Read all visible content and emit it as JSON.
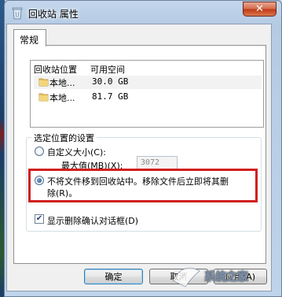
{
  "window": {
    "title": "回收站 属性",
    "close_glyph": "✕"
  },
  "tabs": [
    {
      "label": "常规"
    }
  ],
  "locations": {
    "columns": [
      "回收站位置",
      "可用空间"
    ],
    "rows": [
      {
        "name": "本地...",
        "free_space": "30.0 GB"
      },
      {
        "name": "本地...",
        "free_space": "81.7 GB"
      }
    ]
  },
  "settings": {
    "group_title": "选定位置的设置",
    "custom_size_label": "自定义大小(C):",
    "max_value_label": "最大值(MB)(X):",
    "max_value": "3072",
    "no_recycle_label_line1": "不将文件移到回收站中。移除文件后立即将其删",
    "no_recycle_label_line2": "除(R)。",
    "selected_option": "no_recycle",
    "confirm_delete_label": "显示删除确认对话框(D)",
    "confirm_delete_checked": true
  },
  "buttons": {
    "ok": "确定",
    "cancel": "取消",
    "apply": "应用(A)"
  },
  "watermark": {
    "text": "系统之家"
  },
  "colors": {
    "highlight_box": "#d11f1f",
    "close_button": "#c2391a"
  }
}
